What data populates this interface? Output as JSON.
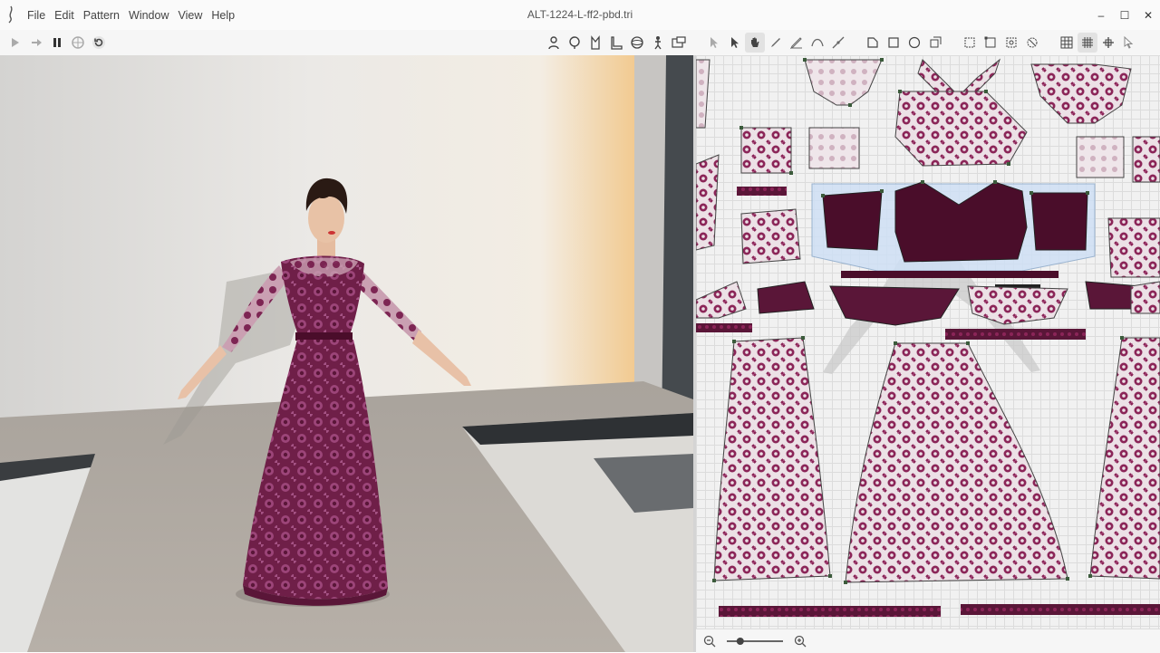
{
  "menu": {
    "items": [
      "File",
      "Edit",
      "Pattern",
      "Window",
      "View",
      "Help"
    ]
  },
  "document": {
    "title": "ALT-1224-L-ff2-pbd.tri"
  },
  "window_controls": {
    "minimize": "–",
    "maximize": "☐",
    "close": "✕"
  },
  "toolbar": {
    "simulation": [
      "play-icon",
      "step-icon",
      "pause-icon",
      "grid-sphere-icon",
      "reset-icon"
    ],
    "avatar_tools": [
      "avatar-icon",
      "head-icon",
      "garment-icon",
      "shoe-icon",
      "sphere-icon",
      "walk-icon",
      "screen-icon"
    ],
    "pattern_tools": [
      "arrow-icon",
      "select-icon",
      "hand-icon",
      "pen-icon",
      "pencil-icon",
      "curve-icon",
      "line-icon",
      "polygon-icon",
      "rectangle-icon",
      "circle-icon",
      "transform-icon",
      "fit-icon",
      "box-icon",
      "measure-icon",
      "group-icon",
      "grid-icon",
      "layout-icon",
      "pointer-icon"
    ]
  },
  "colors": {
    "fabric": "#7d1f4f",
    "fabric_dark": "#4a0d2a",
    "lace_bg": "#eee0e6",
    "grid": "#dcdcdc",
    "selection": "#cfe0f5"
  },
  "zoom": {
    "icons": [
      "zoom-out-icon",
      "zoom-in-icon"
    ],
    "level": 0.2
  }
}
